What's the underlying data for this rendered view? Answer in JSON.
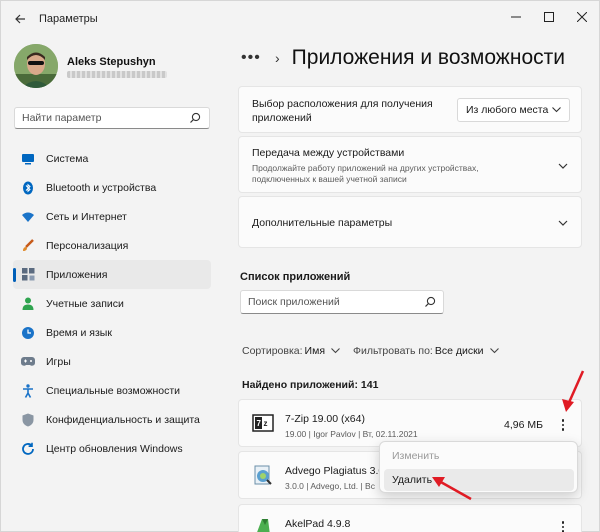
{
  "window": {
    "title": "Параметры"
  },
  "profile": {
    "name": "Aleks Stepushyn"
  },
  "sidebar": {
    "search_placeholder": "Найти параметр",
    "items": [
      {
        "label": "Система",
        "icon": "monitor-icon"
      },
      {
        "label": "Bluetooth и устройства",
        "icon": "bluetooth-icon"
      },
      {
        "label": "Сеть и Интернет",
        "icon": "wifi-icon"
      },
      {
        "label": "Персонализация",
        "icon": "brush-icon"
      },
      {
        "label": "Приложения",
        "icon": "apps-icon",
        "active": true
      },
      {
        "label": "Учетные записи",
        "icon": "person-icon"
      },
      {
        "label": "Время и язык",
        "icon": "globe-clock-icon"
      },
      {
        "label": "Игры",
        "icon": "gamepad-icon"
      },
      {
        "label": "Специальные возможности",
        "icon": "accessibility-icon"
      },
      {
        "label": "Конфиденциальность и защита",
        "icon": "shield-icon"
      },
      {
        "label": "Центр обновления Windows",
        "icon": "update-icon"
      }
    ]
  },
  "header": {
    "dots": "•••",
    "page_title": "Приложения и возможности"
  },
  "settings_cards": {
    "install_source": {
      "title": "Выбор расположения для получения приложений",
      "value": "Из любого места"
    },
    "share_across_devices": {
      "title": "Передача между устройствами",
      "description": "Продолжайте работу приложений на других устройствах, подключенных к вашей учетной записи"
    },
    "advanced": {
      "title": "Дополнительные параметры"
    }
  },
  "app_list": {
    "section_title": "Список приложений",
    "search_placeholder": "Поиск приложений",
    "sort_label": "Сортировка:",
    "sort_value": "Имя",
    "filter_label": "Фильтровать по:",
    "filter_value": "Все диски",
    "found_text": "Найдено приложений: 141",
    "apps": [
      {
        "name": "7-Zip 19.00 (x64)",
        "meta": "19.00  |  Igor Pavlov  |  Вт, 02.11.2021",
        "size": "4,96 МБ"
      },
      {
        "name": "Advego Plagiatus 3.0",
        "meta": "3.0.0  |  Advego, Ltd.  |  Вс"
      },
      {
        "name": "AkelPad 4.9.8"
      }
    ]
  },
  "context_menu": {
    "items": [
      {
        "label": "Изменить",
        "enabled": false
      },
      {
        "label": "Удалить",
        "enabled": true
      }
    ]
  },
  "colors": {
    "accent": "#005fb8",
    "annotation": "#e01b24"
  }
}
